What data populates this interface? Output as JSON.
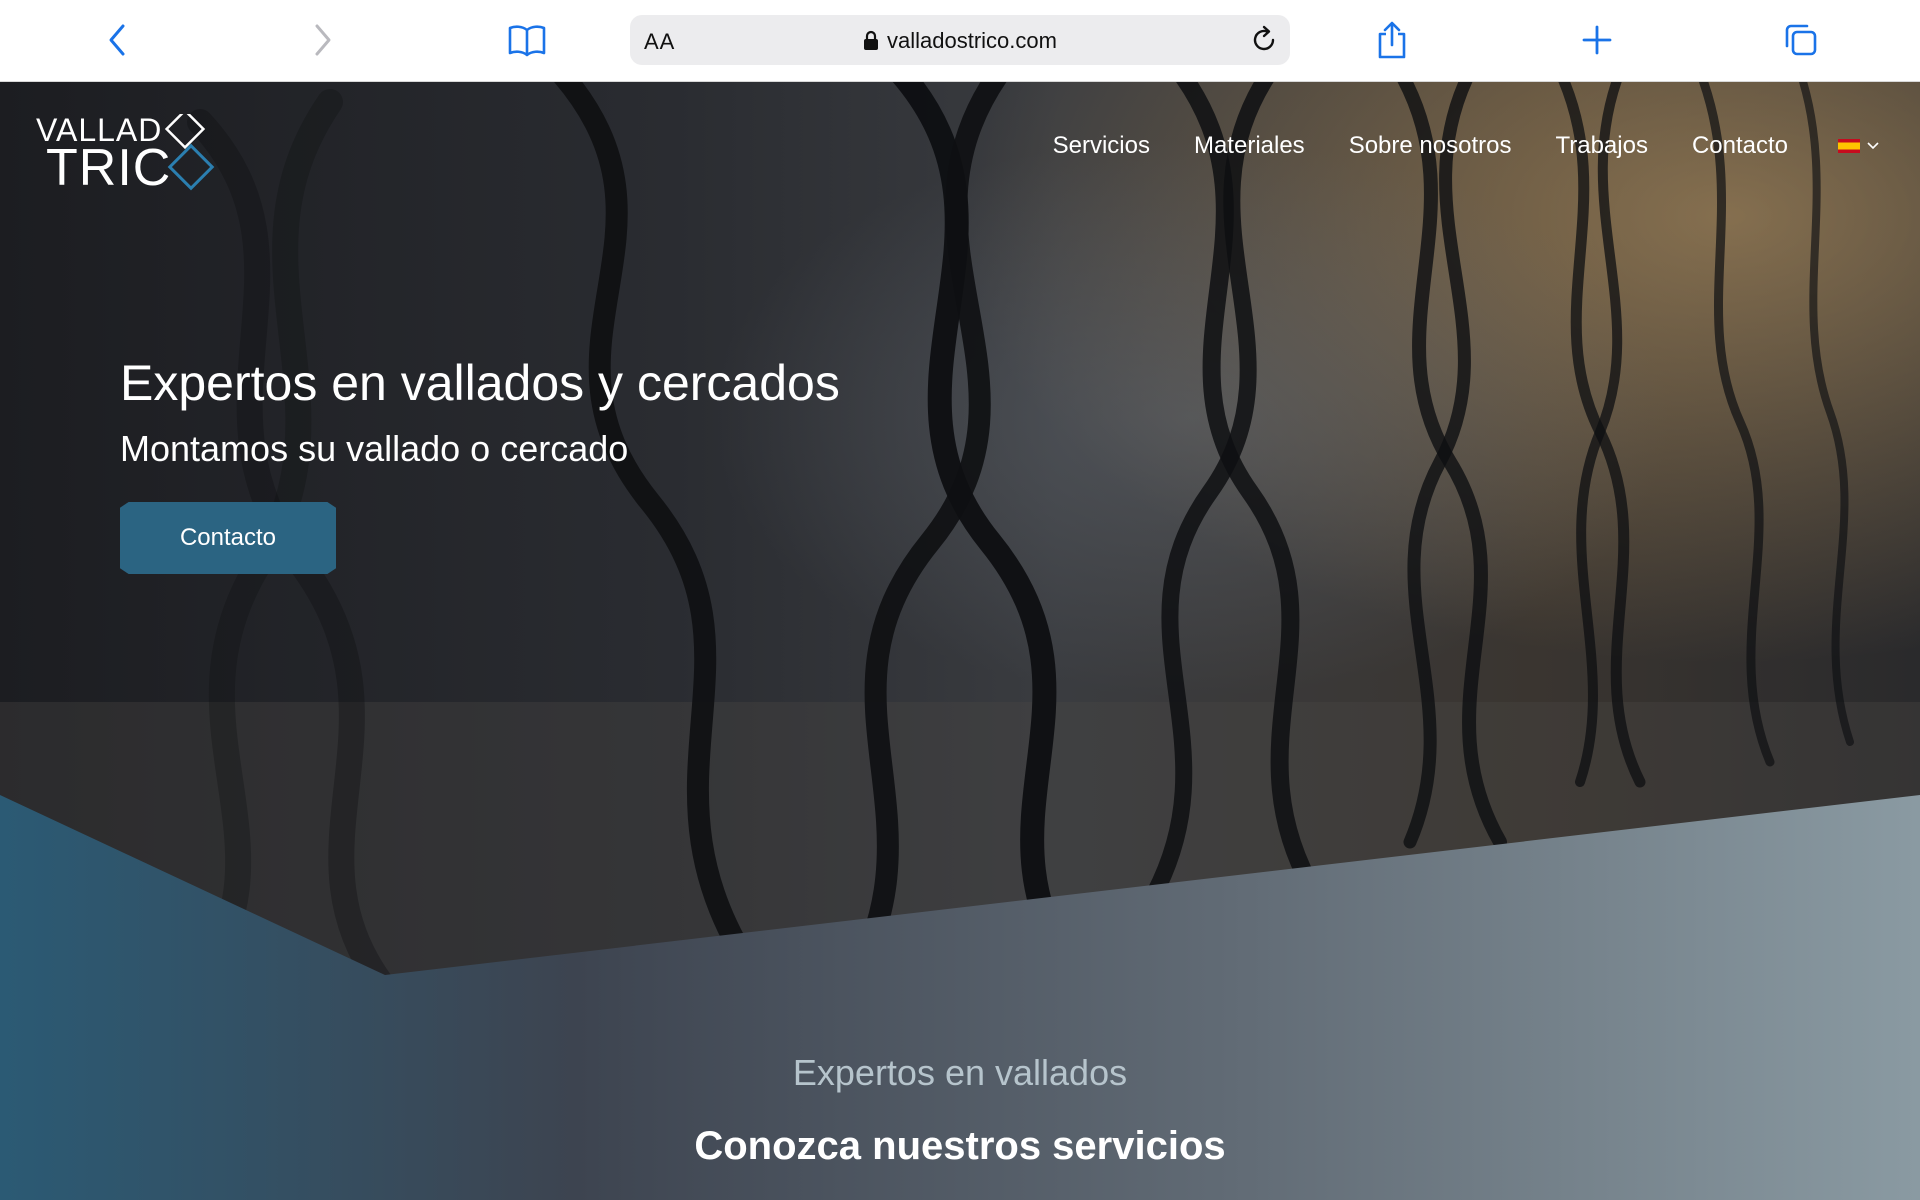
{
  "browser": {
    "text_size_label": "AA",
    "url": "valladostrico.com",
    "icons": [
      "back-icon",
      "forward-icon",
      "bookmarks-icon",
      "lock-icon",
      "reload-icon",
      "share-icon",
      "new-tab-icon",
      "tabs-icon"
    ]
  },
  "site": {
    "logo_line1": "VALLAD",
    "logo_line2": "TRIC",
    "nav": [
      "Servicios",
      "Materiales",
      "Sobre nosotros",
      "Trabajos",
      "Contacto"
    ],
    "language_flag": "es-flag-icon",
    "hero": {
      "title": "Expertos en vallados y cercados",
      "subtitle": "Montamos su vallado o cercado",
      "cta": "Contacto"
    },
    "section": {
      "eyebrow": "Expertos en vallados",
      "heading": "Conozca nuestros servicios"
    }
  },
  "colors": {
    "accent": "#2b6482",
    "toolbar_icon": "#1a73e8",
    "band_left": "#2b5a74",
    "band_right": "#8a9aa2"
  }
}
